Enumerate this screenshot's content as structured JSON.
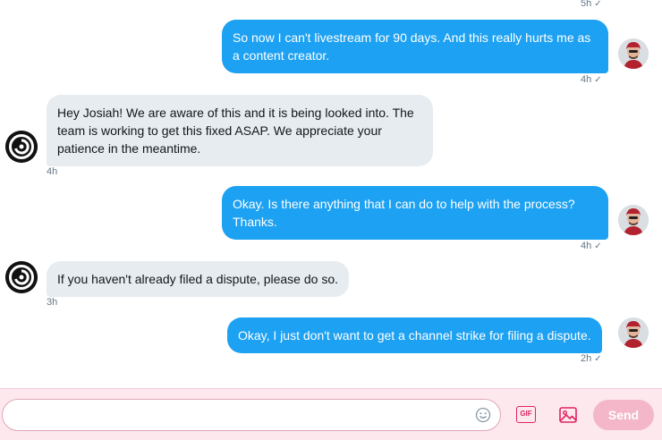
{
  "messages": [
    {
      "direction": "out",
      "time": "5h",
      "text": ""
    },
    {
      "direction": "out",
      "text": "So now I can't livestream for 90 days. And this really hurts me as a content creator.",
      "time": "4h"
    },
    {
      "direction": "in",
      "text": "Hey Josiah! We are aware of this and it is being looked into. The team is working to get this fixed ASAP.  We appreciate your patience in the meantime.",
      "time": "4h"
    },
    {
      "direction": "out",
      "text": "Okay. Is there anything that I can do to help with the process? Thanks.",
      "time": "4h"
    },
    {
      "direction": "in",
      "text": "If you haven't already filed a dispute, please do so.",
      "time": "3h"
    },
    {
      "direction": "out",
      "text": "Okay, I just don't want to get a channel strike for filing a dispute.",
      "time": "2h"
    }
  ],
  "check_mark": "✓",
  "composer": {
    "placeholder": "",
    "emoji_icon": "emoji-icon",
    "gif_label": "GIF",
    "image_icon": "image-icon",
    "send_label": "Send"
  },
  "colors": {
    "outgoing_bubble": "#1da1f2",
    "incoming_bubble": "#e6ecf0",
    "send_disabled": "#f4b7c9",
    "accent": "#e0245e"
  }
}
